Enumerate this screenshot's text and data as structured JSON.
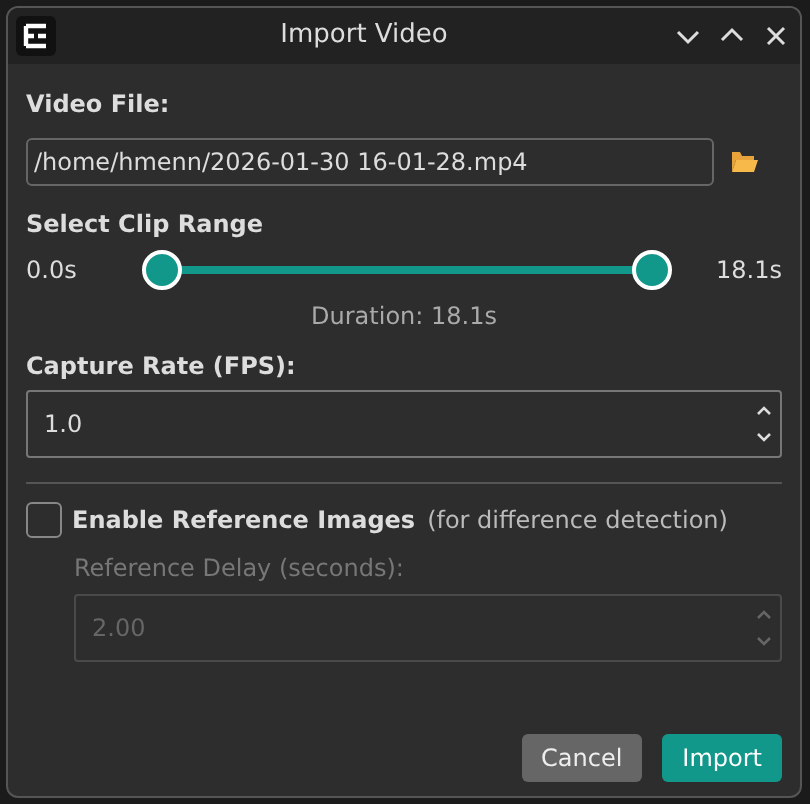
{
  "window": {
    "title": "Import Video"
  },
  "video_file": {
    "label": "Video File:",
    "value": "/home/hmenn/2026-01-30 16-01-28.mp4"
  },
  "clip_range": {
    "label": "Select Clip Range",
    "start_label": "0.0s",
    "end_label": "18.1s",
    "handles": [
      {
        "level": 0
      },
      {
        "level": 1
      }
    ],
    "duration": "Duration: 18.1s"
  },
  "capture_rate": {
    "label": "Capture Rate (FPS):",
    "value": "1.0",
    "disabled": false
  },
  "reference": {
    "label": "Enable Reference Images",
    "hint": "(for difference detection)",
    "checked": false
  },
  "reference_delay": {
    "label": "Reference Delay (seconds):",
    "value": "2.00",
    "disabled": true
  },
  "buttons": [
    {
      "label": "Cancel",
      "kind": "secondary"
    },
    {
      "label": "Import",
      "kind": "primary"
    }
  ]
}
